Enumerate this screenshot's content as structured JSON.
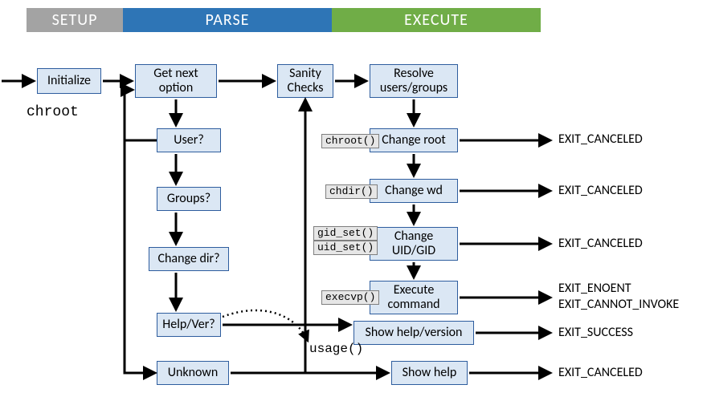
{
  "banner": {
    "setup": "SETUP",
    "parse": "PARSE",
    "execute": "EXECUTE"
  },
  "program": "chroot",
  "usage_label": "usage()",
  "boxes": {
    "initialize": "Initialize",
    "get_next": "Get next option",
    "sanity": "Sanity Checks",
    "resolve": "Resolve users/groups",
    "user_q": "User?",
    "groups_q": "Groups?",
    "changedir_q": "Change dir?",
    "helpver_q": "Help/Ver?",
    "unknown": "Unknown",
    "change_root": "Change root",
    "change_wd": "Change wd",
    "change_uidgid": "Change UID/GID",
    "exec_cmd": "Execute command",
    "show_helpver": "Show help/version",
    "show_help": "Show help"
  },
  "chips": {
    "chroot": "chroot()",
    "chdir": "chdir()",
    "gid_set": "gid_set()",
    "uid_set": "uid_set()",
    "execvp": "execvp()"
  },
  "exits": {
    "root": "EXIT_CANCELED",
    "wd": "EXIT_CANCELED",
    "uidgid": "EXIT_CANCELED",
    "exec": "EXIT_ENOENT\nEXIT_CANNOT_INVOKE",
    "helpver": "EXIT_SUCCESS",
    "help": "EXIT_CANCELED"
  }
}
